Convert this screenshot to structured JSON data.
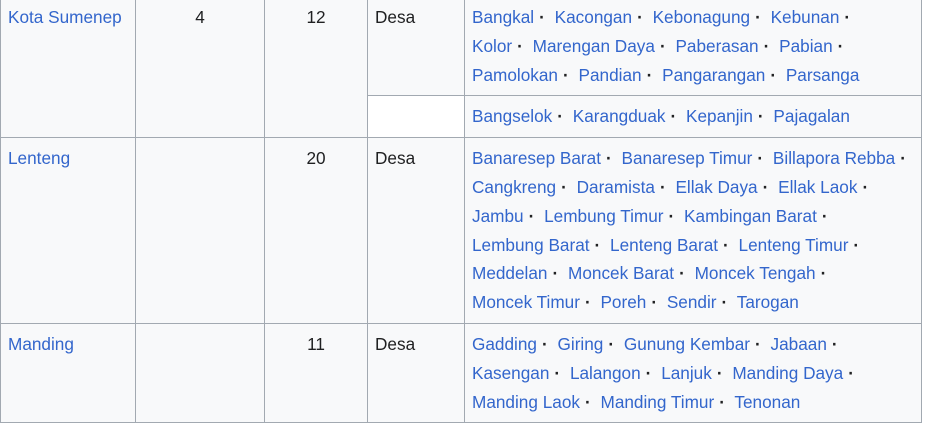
{
  "rows": [
    {
      "district": "Kota Sumenep",
      "kelurahan": "4",
      "desa_count": "12",
      "type": "Desa",
      "villages": [
        "Bangkal",
        "Kacongan",
        "Kebonagung",
        "Kebunan",
        "Kolor",
        "Marengan Daya",
        "Paberasan",
        "Pabian",
        "Pamolokan",
        "Pandian",
        "Pangarangan",
        "Parsanga"
      ],
      "sub_villages": [
        "Bangselok",
        "Karangduak",
        "Kepanjin",
        "Pajagalan"
      ]
    },
    {
      "district": "Lenteng",
      "kelurahan": "",
      "desa_count": "20",
      "type": "Desa",
      "villages": [
        "Banaresep Barat",
        "Banaresep Timur",
        "Billapora Rebba",
        "Cangkreng",
        "Daramista",
        "Ellak Daya",
        "Ellak Laok",
        "Jambu",
        "Lembung Timur",
        "Kambingan Barat",
        "Lembung Barat",
        "Lenteng Barat",
        "Lenteng Timur",
        "Meddelan",
        "Moncek Barat",
        "Moncek Tengah",
        "Moncek Timur",
        "Poreh",
        "Sendir",
        "Tarogan"
      ]
    },
    {
      "district": "Manding",
      "kelurahan": "",
      "desa_count": "11",
      "type": "Desa",
      "villages": [
        "Gadding",
        "Giring",
        "Gunung Kembar",
        "Jabaan",
        "Kasengan",
        "Lalangon",
        "Lanjuk",
        "Manding Daya",
        "Manding Laok",
        "Manding Timur",
        "Tenonan"
      ]
    }
  ]
}
